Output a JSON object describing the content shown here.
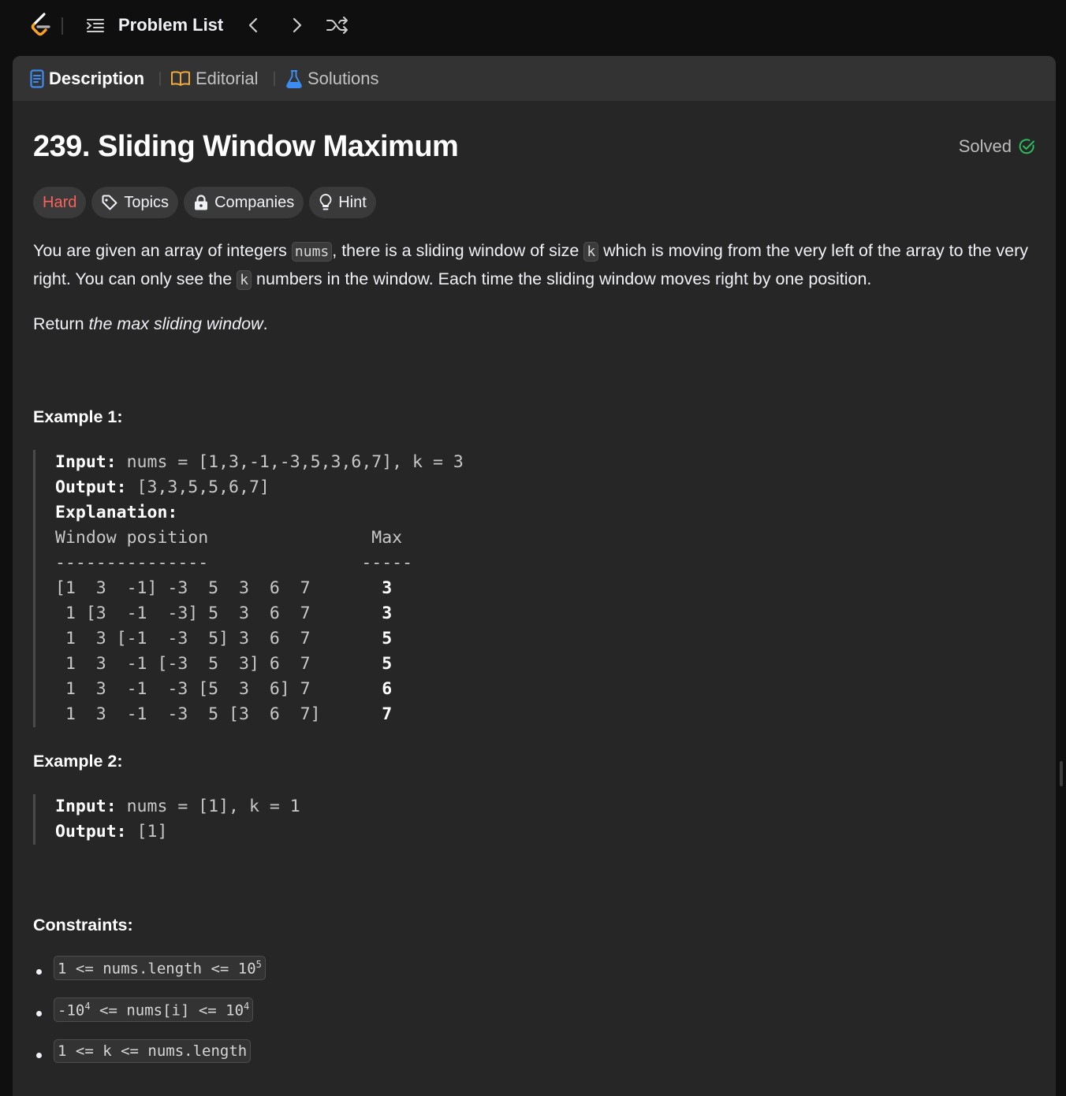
{
  "navbar": {
    "problem_list_label": "Problem List",
    "icons": [
      "leetcode-logo",
      "list-icon",
      "chevron-left-icon",
      "chevron-right-icon",
      "shuffle-icon"
    ]
  },
  "tabs": [
    {
      "label": "Description",
      "icon": "document-icon",
      "active": true,
      "color": "#3c8cf2"
    },
    {
      "label": "Editorial",
      "icon": "book-icon",
      "active": false,
      "color": "#f0a93b"
    },
    {
      "label": "Solutions",
      "icon": "flask-icon",
      "active": false,
      "color": "#3c8cf2"
    }
  ],
  "problem": {
    "title": "239. Sliding Window Maximum",
    "status": "Solved",
    "difficulty": "Hard",
    "difficulty_color": "#f8615c",
    "chips": [
      "Topics",
      "Companies",
      "Hint"
    ]
  },
  "description": {
    "p1_a": "You are given an array of integers ",
    "p1_code1": "nums",
    "p1_b": ", there is a sliding window of size ",
    "p1_code2": "k",
    "p1_c": " which is moving from the very left of the array to the very right. You can only see the ",
    "p1_code3": "k",
    "p1_d": " numbers in the window. Each time the sliding window moves right by one position.",
    "p2_a": "Return ",
    "p2_em": "the max sliding window",
    "p2_b": "."
  },
  "example1": {
    "heading": "Example 1:",
    "input_label": "Input:",
    "input_value": " nums = [1,3,-1,-3,5,3,6,7], k = 3",
    "output_label": "Output:",
    "output_value": " [3,3,5,5,6,7]",
    "explanation_label": "Explanation:",
    "header_row": "Window position                Max",
    "dash_row": "---------------               -----",
    "rows": [
      {
        "window": "[1  3  -1] -3  5  3  6  7       ",
        "max": "3"
      },
      {
        "window": " 1 [3  -1  -3] 5  3  6  7       ",
        "max": "3"
      },
      {
        "window": " 1  3 [-1  -3  5] 3  6  7       ",
        "max": "5"
      },
      {
        "window": " 1  3  -1 [-3  5  3] 6  7       ",
        "max": "5"
      },
      {
        "window": " 1  3  -1  -3 [5  3  6] 7       ",
        "max": "6"
      },
      {
        "window": " 1  3  -1  -3  5 [3  6  7]      ",
        "max": "7"
      }
    ]
  },
  "example2": {
    "heading": "Example 2:",
    "input_label": "Input:",
    "input_value": " nums = [1], k = 1",
    "output_label": "Output:",
    "output_value": " [1]"
  },
  "constraints": {
    "heading": "Constraints:",
    "items": [
      {
        "pre": "1 <= nums.length <= 10",
        "sup": "5",
        "post": ""
      },
      {
        "pre": "-10",
        "sup": "4",
        "mid": " <= nums[i] <= 10",
        "sup2": "4"
      },
      {
        "pre": "1 <= k <= nums.length"
      }
    ]
  }
}
